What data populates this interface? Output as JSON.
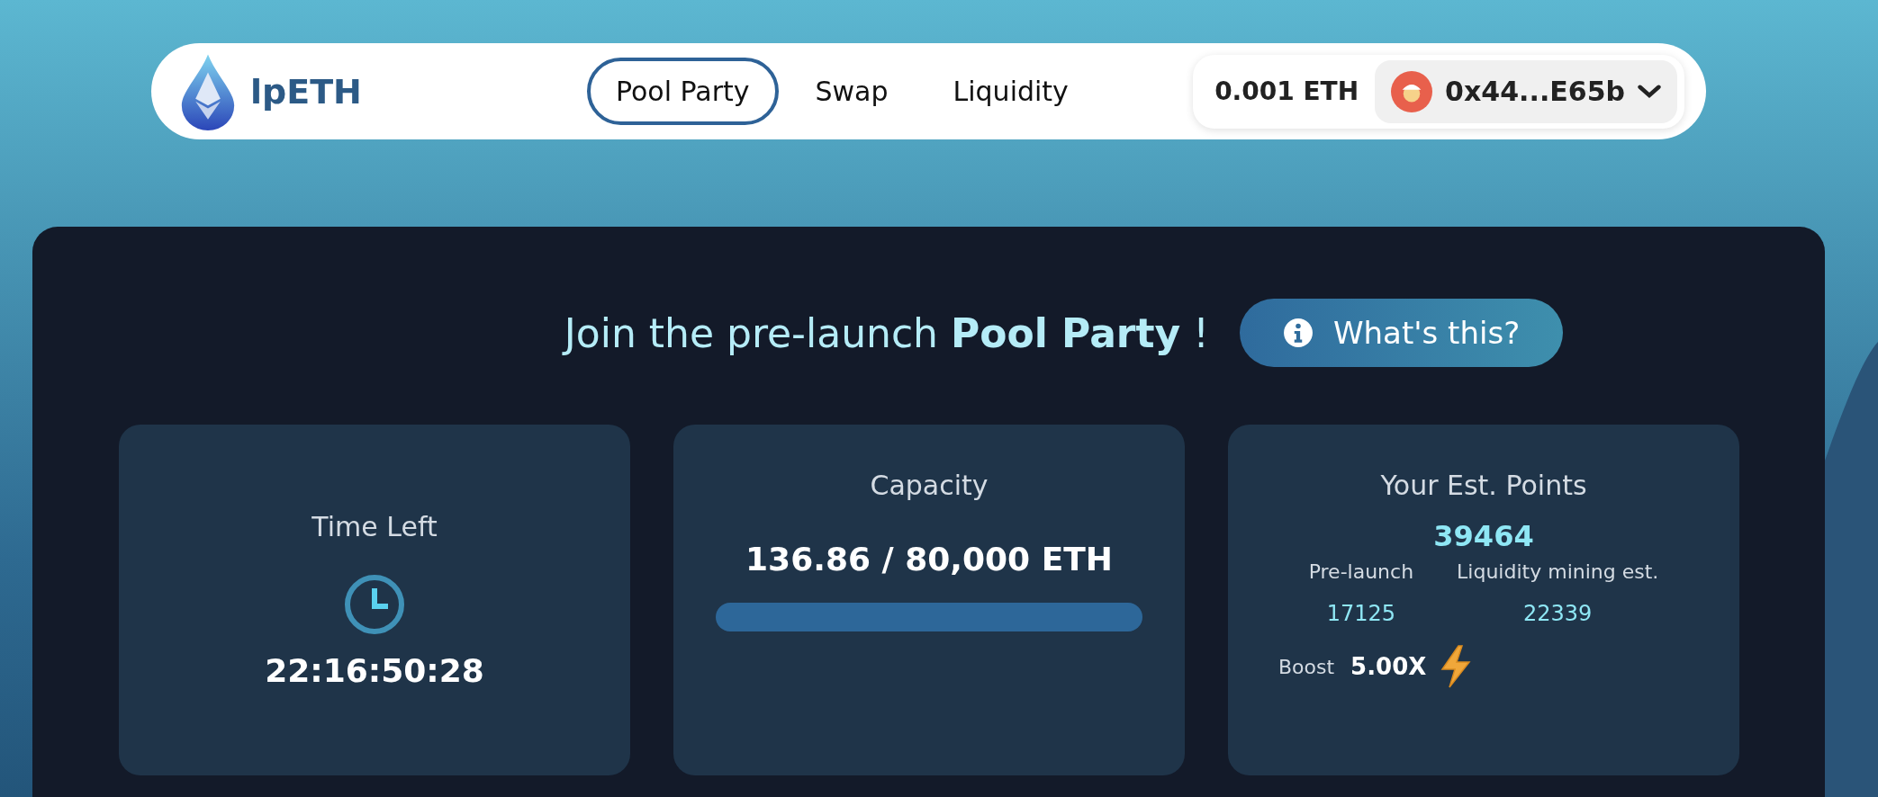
{
  "brand": {
    "name": "lpETH"
  },
  "nav": [
    {
      "label": "Pool Party",
      "selected": true
    },
    {
      "label": "Swap",
      "selected": false
    },
    {
      "label": "Liquidity",
      "selected": false
    }
  ],
  "wallet": {
    "balance": "0.001 ETH",
    "address": "0x44...E65b"
  },
  "hero": {
    "prefix": "Join the pre-launch",
    "highlight": "Pool Party",
    "suffix": "!",
    "button": "What's this?"
  },
  "cards": [
    {
      "kind": "timer",
      "title": "Time Left",
      "value": "22:16:50:28"
    },
    {
      "kind": "capacity",
      "title": "Capacity",
      "value": "136.86 / 80,000 ETH"
    },
    {
      "kind": "points",
      "title": "Your Est. Points",
      "value": "39464",
      "breakdown": [
        {
          "label": "Pre-launch",
          "value": "17125"
        },
        {
          "label": "Liquidity mining est.",
          "value": "22339"
        }
      ],
      "boost_label": "Boost",
      "boost_value": "5.00X"
    }
  ]
}
